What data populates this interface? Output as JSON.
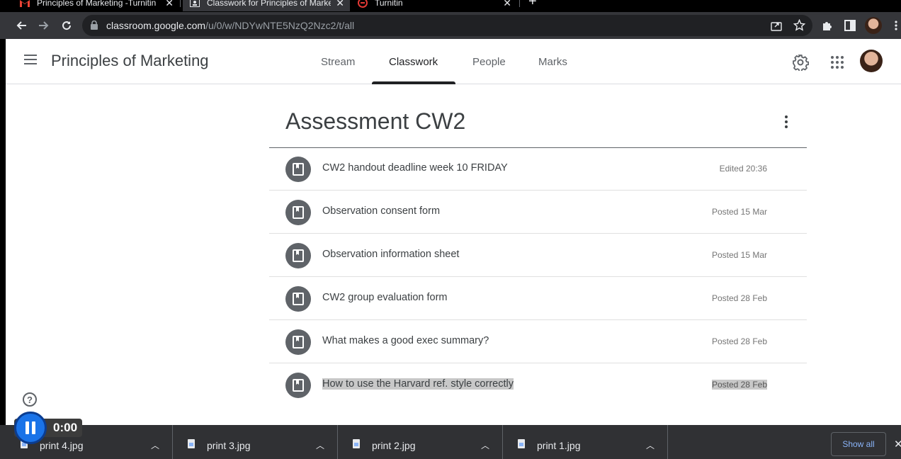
{
  "browser": {
    "tabs": [
      {
        "title": "Principles of Marketing -Turnitin",
        "active": false
      },
      {
        "title": "Classwork for Principles of Marketing",
        "active": true
      },
      {
        "title": "Turnitin",
        "active": false
      }
    ],
    "new_tab": "+",
    "url_host": "classroom.google.com",
    "url_path": "/u/0/w/NDYwNTE5NzQ2Nzc2/t/all"
  },
  "classroom": {
    "course_title": "Principles of Marketing",
    "nav_tabs": [
      "Stream",
      "Classwork",
      "People",
      "Marks"
    ],
    "active_tab": "Classwork"
  },
  "section": {
    "title": "Assessment CW2",
    "materials": [
      {
        "title": "CW2 handout deadline week 10 FRIDAY",
        "date": "Edited 20:36",
        "highlighted": false
      },
      {
        "title": "Observation consent form",
        "date": "Posted 15 Mar",
        "highlighted": false
      },
      {
        "title": "Observation information sheet",
        "date": "Posted 15 Mar",
        "highlighted": false
      },
      {
        "title": "CW2 group evaluation form",
        "date": "Posted 28 Feb",
        "highlighted": false
      },
      {
        "title": "What makes a good exec summary?",
        "date": "Posted 28 Feb",
        "highlighted": false
      },
      {
        "title": "How to use the Harvard ref. style correctly",
        "date": "Posted 28 Feb",
        "highlighted": true
      }
    ]
  },
  "help": "?",
  "recording": {
    "time": "0:00"
  },
  "downloads": {
    "items": [
      "print 4.jpg",
      "print 3.jpg",
      "print 2.jpg",
      "print 1.jpg"
    ],
    "show_all": "Show all"
  },
  "colors": {
    "accent_blue": "#1a73e8",
    "toolbar": "#35363a",
    "download_bar": "#303134"
  }
}
